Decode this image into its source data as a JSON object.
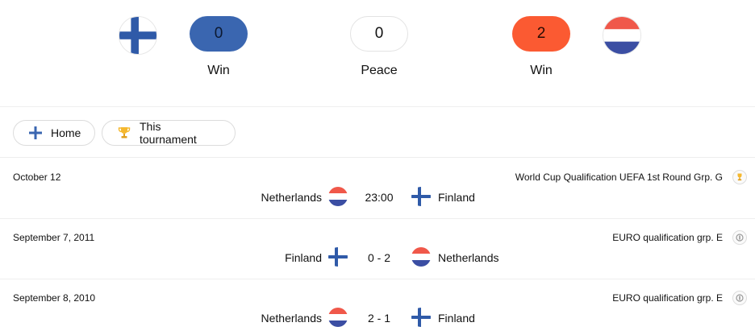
{
  "summary": {
    "home": {
      "flag": "finland-flag",
      "count": "0",
      "label": "Win",
      "color": "#3a66b0"
    },
    "draw": {
      "count": "0",
      "label": "Peace"
    },
    "away": {
      "flag": "netherlands-flag",
      "count": "2",
      "label": "Win",
      "color": "#fb5a32"
    }
  },
  "filters": [
    {
      "label": "Home",
      "icon": "plus-cross-icon"
    },
    {
      "label": "This tournament",
      "icon": "trophy-icon"
    }
  ],
  "matches": [
    {
      "date": "October 12",
      "competition": "World Cup Qualification UEFA 1st Round Grp. G",
      "competition_icon": "trophy-icon",
      "team_left": "Netherlands",
      "flag_left": "netherlands-flag",
      "score": "23:00",
      "team_right": "Finland",
      "flag_right": "finland-flag"
    },
    {
      "date": "September 7, 2011",
      "competition": "EURO qualification grp. E",
      "competition_icon": "euro-icon",
      "team_left": "Finland",
      "flag_left": "finland-flag",
      "score": "0 - 2",
      "team_right": "Netherlands",
      "flag_right": "netherlands-flag"
    },
    {
      "date": "September 8, 2010",
      "competition": "EURO qualification grp. E",
      "competition_icon": "euro-icon",
      "team_left": "Netherlands",
      "flag_left": "netherlands-flag",
      "score": "2 - 1",
      "team_right": "Finland",
      "flag_right": "finland-flag"
    }
  ]
}
